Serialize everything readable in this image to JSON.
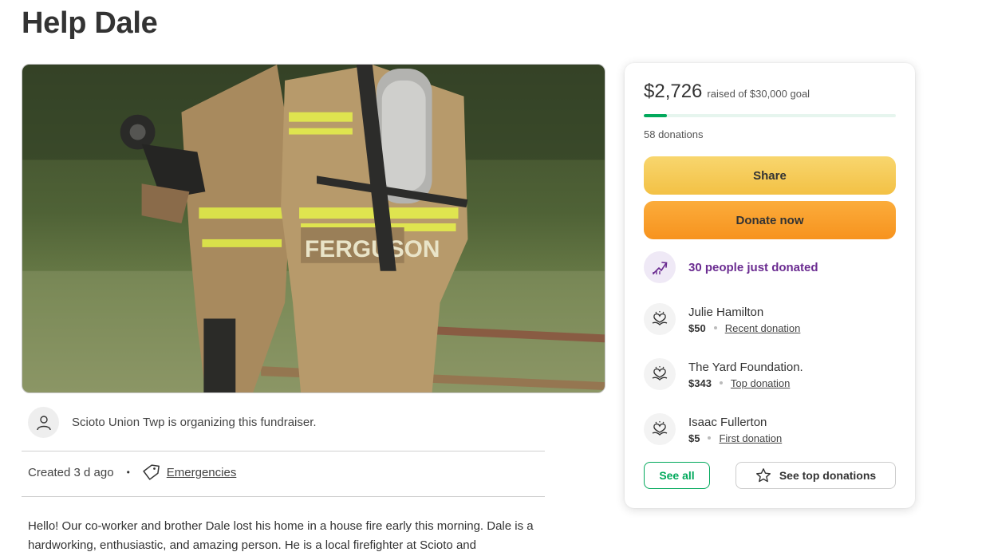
{
  "page": {
    "title": "Help Dale"
  },
  "hero": {
    "nametag_text": "FERGUSON"
  },
  "organizer": {
    "text": "Scioto Union Twp is organizing this fundraiser."
  },
  "meta": {
    "created": "Created 3 d ago",
    "separator": "•",
    "category": "Emergencies"
  },
  "story": {
    "text": "Hello! Our co-worker and brother Dale lost his home in a house fire early this morning. Dale is a hardworking, enthusiastic, and amazing person. He is a local firefighter at Scioto and"
  },
  "card": {
    "raised": "$2,726",
    "goal_text": "raised of $30,000 goal",
    "progress_fraction": 0.0909,
    "donation_count": "58 donations",
    "share_label": "Share",
    "donate_label": "Donate now",
    "trend_text": "30 people just donated",
    "donors": [
      {
        "name": "Julie Hamilton",
        "amount": "$50",
        "tag": "Recent donation"
      },
      {
        "name": "The Yard Foundation.",
        "amount": "$343",
        "tag": "Top donation"
      },
      {
        "name": "Isaac Fullerton",
        "amount": "$5",
        "tag": "First donation"
      }
    ],
    "see_all_label": "See all",
    "see_top_label": "See top donations"
  },
  "colors": {
    "accent_green": "#02a95c",
    "share_yellow": "#f3c145",
    "donate_orange": "#f7931e",
    "trend_purple": "#6b2c91"
  }
}
